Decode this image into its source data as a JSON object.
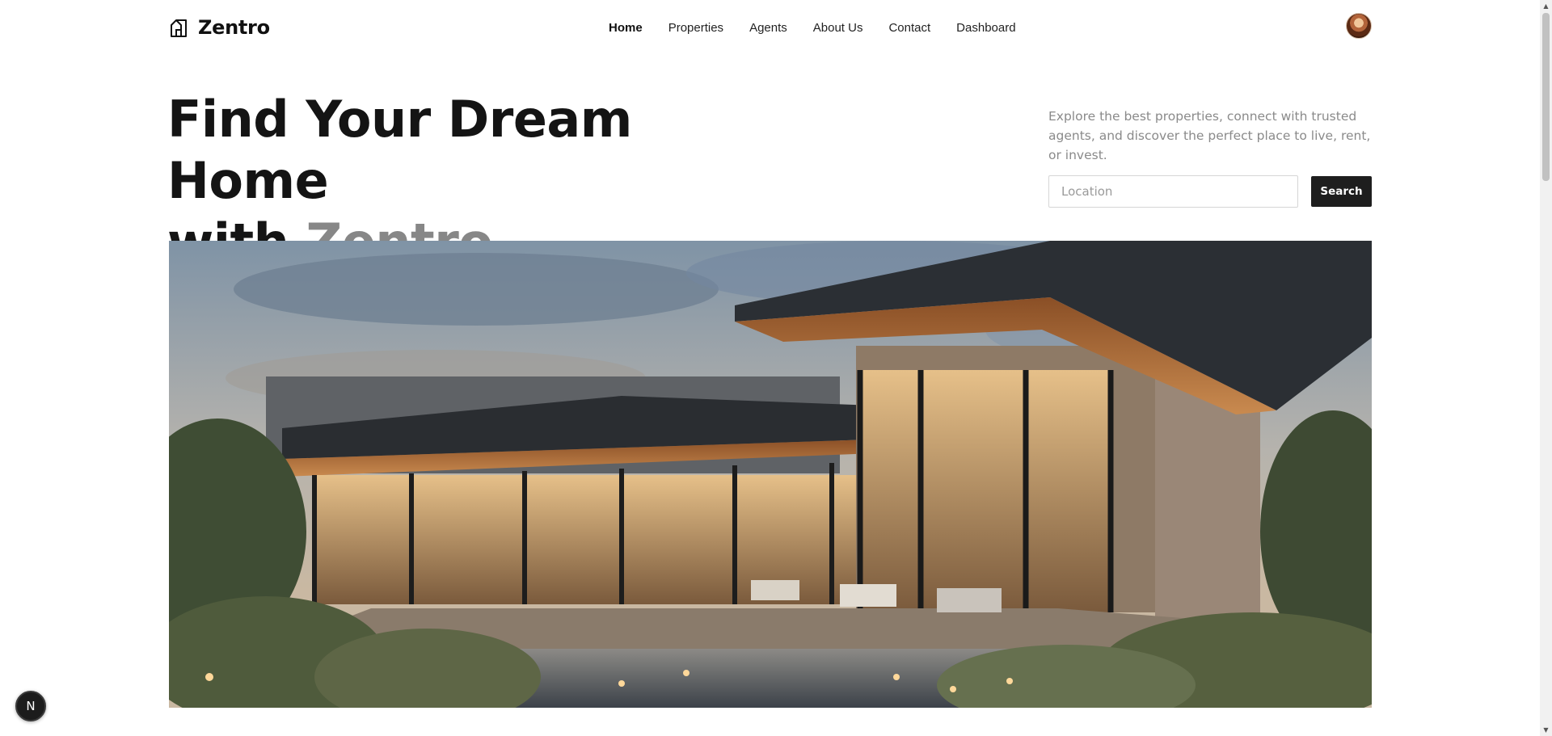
{
  "brand": {
    "name": "Zentro",
    "icon": "house-icon"
  },
  "nav": {
    "items": [
      {
        "label": "Home",
        "active": true
      },
      {
        "label": "Properties",
        "active": false
      },
      {
        "label": "Agents",
        "active": false
      },
      {
        "label": "About Us",
        "active": false
      },
      {
        "label": "Contact",
        "active": false
      },
      {
        "label": "Dashboard",
        "active": false
      }
    ],
    "avatar": "user-avatar"
  },
  "hero": {
    "title_line1": "Find Your Dream Home",
    "title_prefix": "with",
    "title_highlight": "Zentro",
    "description": "Explore the best properties, connect with trusted agents, and discover the perfect place to live, rent, or invest.",
    "search": {
      "placeholder": "Location",
      "value": "",
      "button_label": "Search"
    },
    "image": "modern-house-with-pool-at-dusk"
  },
  "badge": {
    "label": "N"
  },
  "colors": {
    "text": "#141414",
    "muted_title": "#878787",
    "description": "#8a8a8a",
    "button_bg": "#1e1e1e",
    "button_text": "#ffffff"
  }
}
